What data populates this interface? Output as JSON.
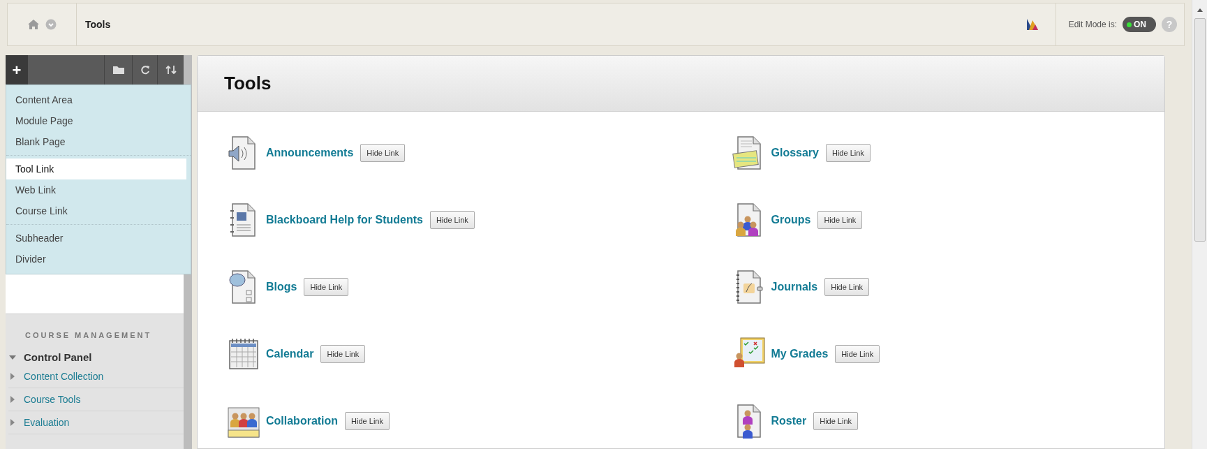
{
  "breadcrumb": {
    "title": "Tools"
  },
  "edit_mode": {
    "label": "Edit Mode is:",
    "on": true,
    "state_text": "ON",
    "help": "?"
  },
  "sidebar": {
    "add_button": "+",
    "add_menu": [
      {
        "items": [
          {
            "label": "Content Area",
            "selected": false
          },
          {
            "label": "Module Page",
            "selected": false
          },
          {
            "label": "Blank Page",
            "selected": false
          }
        ]
      },
      {
        "items": [
          {
            "label": "Tool Link",
            "selected": true
          },
          {
            "label": "Web Link",
            "selected": false
          },
          {
            "label": "Course Link",
            "selected": false
          }
        ]
      },
      {
        "items": [
          {
            "label": "Subheader",
            "selected": false
          },
          {
            "label": "Divider",
            "selected": false
          }
        ]
      }
    ],
    "section_title": "COURSE MANAGEMENT",
    "tree": [
      {
        "label": "Control Panel",
        "expanded": true,
        "children": [
          {
            "label": "Content Collection",
            "expanded": false
          },
          {
            "label": "Course Tools",
            "expanded": false
          },
          {
            "label": "Evaluation",
            "expanded": false
          }
        ]
      }
    ]
  },
  "page": {
    "title": "Tools",
    "tools": [
      {
        "label": "Announcements",
        "kind": "speaker",
        "button": "Hide Link"
      },
      {
        "label": "Glossary",
        "kind": "glossary",
        "button": "Hide Link"
      },
      {
        "label": "Blackboard Help for Students",
        "kind": "manual",
        "button": "Hide Link"
      },
      {
        "label": "Groups",
        "kind": "groups",
        "button": "Hide Link"
      },
      {
        "label": "Blogs",
        "kind": "blog",
        "button": "Hide Link"
      },
      {
        "label": "Journals",
        "kind": "journal",
        "button": "Hide Link"
      },
      {
        "label": "Calendar",
        "kind": "calendar",
        "button": "Hide Link"
      },
      {
        "label": "My Grades",
        "kind": "grades",
        "button": "Hide Link"
      },
      {
        "label": "Collaboration",
        "kind": "people",
        "button": "Hide Link"
      },
      {
        "label": "Roster",
        "kind": "roster",
        "button": "Hide Link"
      }
    ]
  }
}
